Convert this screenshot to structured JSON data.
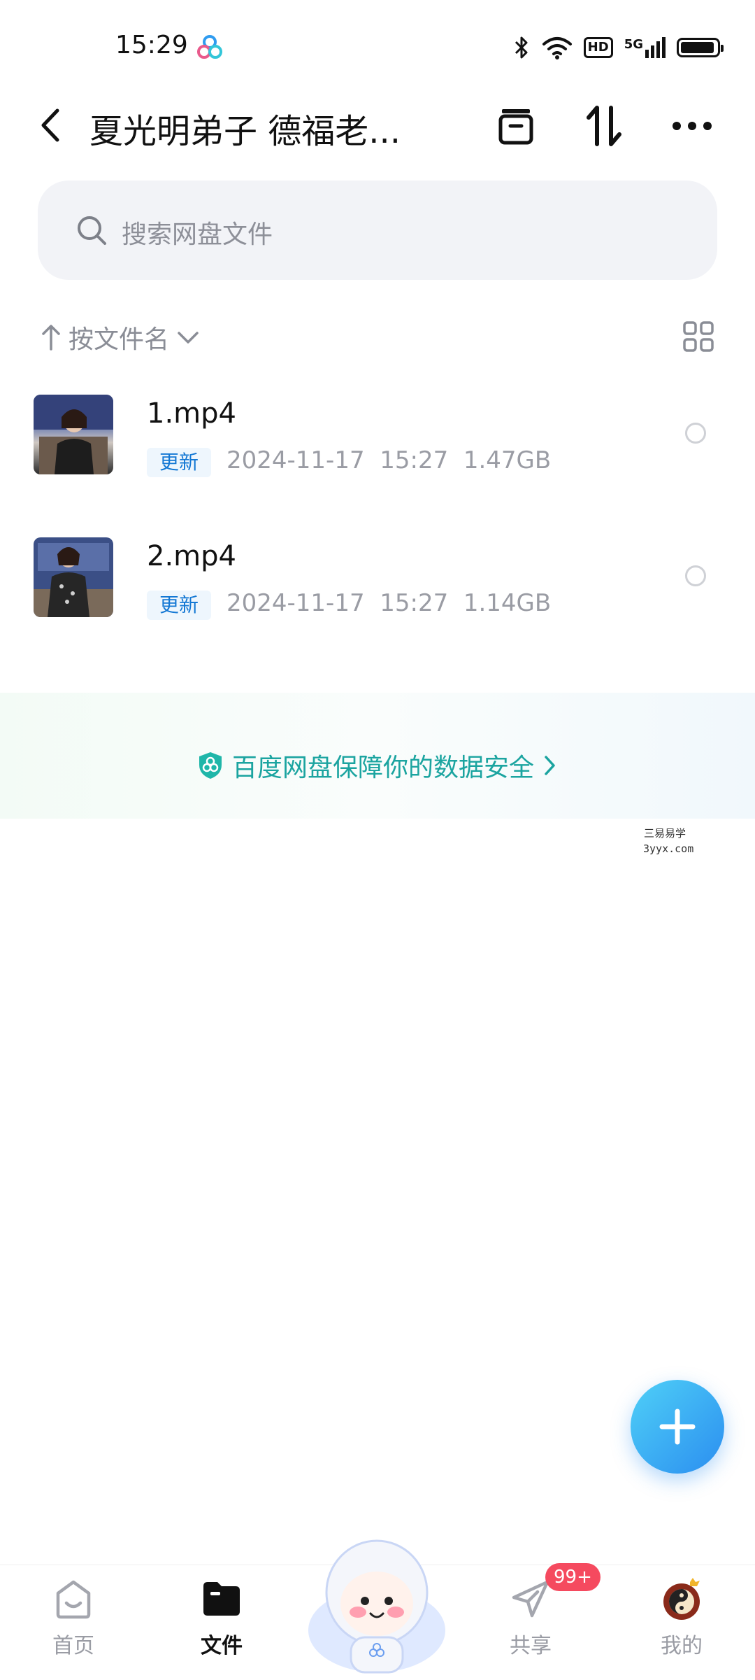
{
  "status_bar": {
    "time": "15:29",
    "app_icon": "baidu-netdisk-icon",
    "indicators": [
      "bluetooth-icon",
      "wifi-icon",
      "HD",
      "5G",
      "battery-icon"
    ],
    "hd_label": "HD",
    "network_label": "5G",
    "battery_level": 0.95
  },
  "header": {
    "back_icon": "chevron-left-icon",
    "title": "夏光明弟子 德福老...",
    "actions": [
      "archive-icon",
      "transfer-icon",
      "more-icon"
    ]
  },
  "search": {
    "placeholder": "搜索网盘文件",
    "icon": "search-icon"
  },
  "sort": {
    "direction_icon": "arrow-up-icon",
    "label": "按文件名",
    "dropdown_icon": "chevron-down-icon",
    "view_toggle_icon": "grid-view-icon"
  },
  "files": [
    {
      "name": "1.mp4",
      "badge": "更新",
      "date": "2024-11-17",
      "time": "15:27",
      "size": "1.47GB"
    },
    {
      "name": "2.mp4",
      "badge": "更新",
      "date": "2024-11-17",
      "time": "15:27",
      "size": "1.14GB"
    }
  ],
  "banner": {
    "icon": "shield-icon",
    "text": "百度网盘保障你的数据安全",
    "arrow_icon": "chevron-right-icon"
  },
  "watermark": {
    "line1": "三易易学",
    "line2": "3yyx.com"
  },
  "fab": {
    "icon": "plus-icon"
  },
  "bottom_nav": {
    "items": [
      {
        "label": "首页",
        "icon": "home-icon",
        "active": false
      },
      {
        "label": "文件",
        "icon": "folder-icon",
        "active": true
      },
      {
        "label": "",
        "icon": "mascot-icon",
        "active": false
      },
      {
        "label": "共享",
        "icon": "share-icon",
        "active": false
      },
      {
        "label": "我的",
        "icon": "profile-icon",
        "active": false
      }
    ],
    "share_badge": "99+"
  },
  "colors": {
    "accent": "#2b8ef0",
    "badge_bg": "#eef6fd",
    "badge_text": "#1478d4",
    "banner_text": "#1ba4a0",
    "notification": "#f54a5f"
  }
}
